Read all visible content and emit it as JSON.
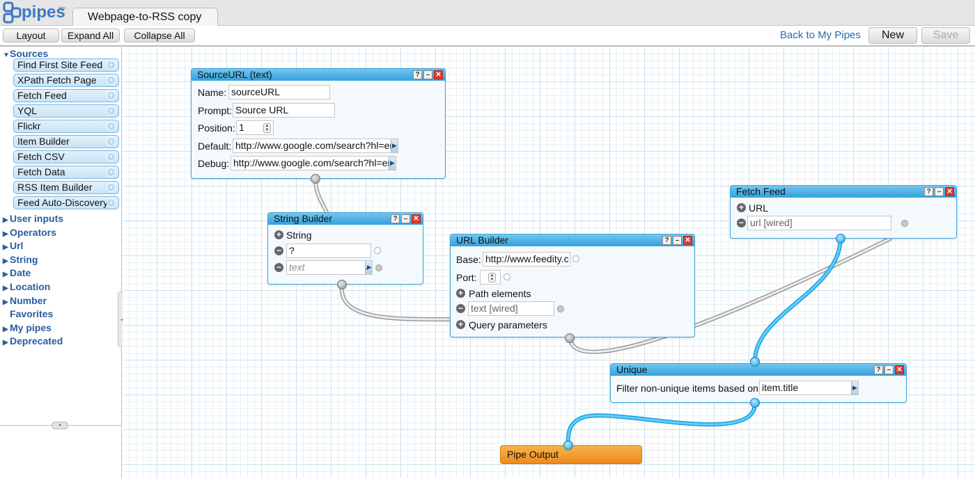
{
  "app": {
    "logo_text": "pipes",
    "logo_tm": "beta",
    "document_tab": "Webpage-to-RSS copy"
  },
  "toolbar": {
    "layout": "Layout",
    "expand_all": "Expand All",
    "collapse_all": "Collapse All",
    "back_link": "Back to My Pipes",
    "new": "New",
    "save": "Save"
  },
  "sidebar": {
    "sources_label": "Sources",
    "source_modules": [
      "Find First Site Feed",
      "XPath Fetch Page",
      "Fetch Feed",
      "YQL",
      "Flickr",
      "Item Builder",
      "Fetch CSV",
      "Fetch Data",
      "RSS Item Builder",
      "Feed Auto-Discovery"
    ],
    "categories": [
      "User inputs",
      "Operators",
      "Url",
      "String",
      "Date",
      "Location",
      "Number",
      "Favorites",
      "My pipes",
      "Deprecated"
    ]
  },
  "modules": {
    "source_url": {
      "title": "SourceURL (text)",
      "name_label": "Name:",
      "name_value": "sourceURL",
      "prompt_label": "Prompt:",
      "prompt_value": "Source URL",
      "position_label": "Position:",
      "position_value": "1",
      "default_label": "Default:",
      "default_value": "http://www.google.com/search?hl=en",
      "debug_label": "Debug:",
      "debug_value": "http://www.google.com/search?hl=en"
    },
    "string_builder": {
      "title": "String Builder",
      "string_label": "String",
      "field1_value": "?",
      "field2_placeholder": "text"
    },
    "url_builder": {
      "title": "URL Builder",
      "base_label": "Base:",
      "base_value": "http://www.feedity.c",
      "port_label": "Port:",
      "path_label": "Path elements",
      "path_value": "text [wired]",
      "query_label": "Query parameters"
    },
    "fetch_feed": {
      "title": "Fetch Feed",
      "url_label": "URL",
      "url_value": "url [wired]"
    },
    "unique": {
      "title": "Unique",
      "filter_label": "Filter non-unique items based on",
      "filter_value": "item.title"
    },
    "pipe_output": {
      "title": "Pipe Output"
    }
  },
  "header_buttons": {
    "help": "?",
    "minimize": "–",
    "close": "✕"
  },
  "colors": {
    "module_header": "#34a0dc",
    "module_border": "#3fa7dc",
    "wire_active": "#3bb8ec",
    "wire_inactive": "#c8c8c8",
    "output_module": "#ee8a1c",
    "link": "#2b67b3"
  }
}
